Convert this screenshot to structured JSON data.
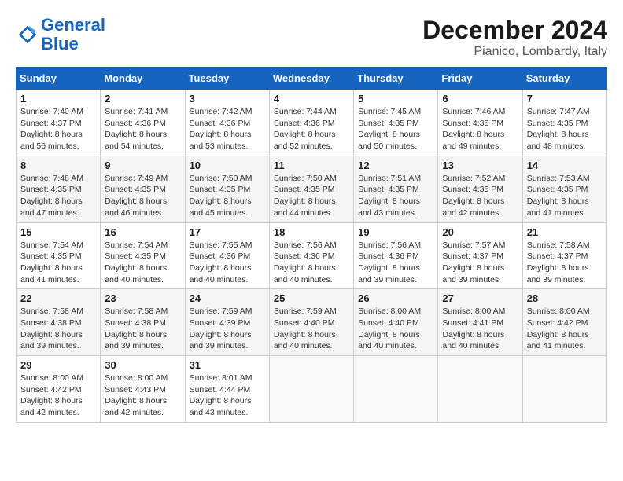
{
  "header": {
    "logo_line1": "General",
    "logo_line2": "Blue",
    "month": "December 2024",
    "location": "Pianico, Lombardy, Italy"
  },
  "weekdays": [
    "Sunday",
    "Monday",
    "Tuesday",
    "Wednesday",
    "Thursday",
    "Friday",
    "Saturday"
  ],
  "weeks": [
    [
      {
        "day": "1",
        "sunrise": "7:40 AM",
        "sunset": "4:37 PM",
        "daylight": "8 hours and 56 minutes."
      },
      {
        "day": "2",
        "sunrise": "7:41 AM",
        "sunset": "4:36 PM",
        "daylight": "8 hours and 54 minutes."
      },
      {
        "day": "3",
        "sunrise": "7:42 AM",
        "sunset": "4:36 PM",
        "daylight": "8 hours and 53 minutes."
      },
      {
        "day": "4",
        "sunrise": "7:44 AM",
        "sunset": "4:36 PM",
        "daylight": "8 hours and 52 minutes."
      },
      {
        "day": "5",
        "sunrise": "7:45 AM",
        "sunset": "4:35 PM",
        "daylight": "8 hours and 50 minutes."
      },
      {
        "day": "6",
        "sunrise": "7:46 AM",
        "sunset": "4:35 PM",
        "daylight": "8 hours and 49 minutes."
      },
      {
        "day": "7",
        "sunrise": "7:47 AM",
        "sunset": "4:35 PM",
        "daylight": "8 hours and 48 minutes."
      }
    ],
    [
      {
        "day": "8",
        "sunrise": "7:48 AM",
        "sunset": "4:35 PM",
        "daylight": "8 hours and 47 minutes."
      },
      {
        "day": "9",
        "sunrise": "7:49 AM",
        "sunset": "4:35 PM",
        "daylight": "8 hours and 46 minutes."
      },
      {
        "day": "10",
        "sunrise": "7:50 AM",
        "sunset": "4:35 PM",
        "daylight": "8 hours and 45 minutes."
      },
      {
        "day": "11",
        "sunrise": "7:50 AM",
        "sunset": "4:35 PM",
        "daylight": "8 hours and 44 minutes."
      },
      {
        "day": "12",
        "sunrise": "7:51 AM",
        "sunset": "4:35 PM",
        "daylight": "8 hours and 43 minutes."
      },
      {
        "day": "13",
        "sunrise": "7:52 AM",
        "sunset": "4:35 PM",
        "daylight": "8 hours and 42 minutes."
      },
      {
        "day": "14",
        "sunrise": "7:53 AM",
        "sunset": "4:35 PM",
        "daylight": "8 hours and 41 minutes."
      }
    ],
    [
      {
        "day": "15",
        "sunrise": "7:54 AM",
        "sunset": "4:35 PM",
        "daylight": "8 hours and 41 minutes."
      },
      {
        "day": "16",
        "sunrise": "7:54 AM",
        "sunset": "4:35 PM",
        "daylight": "8 hours and 40 minutes."
      },
      {
        "day": "17",
        "sunrise": "7:55 AM",
        "sunset": "4:36 PM",
        "daylight": "8 hours and 40 minutes."
      },
      {
        "day": "18",
        "sunrise": "7:56 AM",
        "sunset": "4:36 PM",
        "daylight": "8 hours and 40 minutes."
      },
      {
        "day": "19",
        "sunrise": "7:56 AM",
        "sunset": "4:36 PM",
        "daylight": "8 hours and 39 minutes."
      },
      {
        "day": "20",
        "sunrise": "7:57 AM",
        "sunset": "4:37 PM",
        "daylight": "8 hours and 39 minutes."
      },
      {
        "day": "21",
        "sunrise": "7:58 AM",
        "sunset": "4:37 PM",
        "daylight": "8 hours and 39 minutes."
      }
    ],
    [
      {
        "day": "22",
        "sunrise": "7:58 AM",
        "sunset": "4:38 PM",
        "daylight": "8 hours and 39 minutes."
      },
      {
        "day": "23",
        "sunrise": "7:58 AM",
        "sunset": "4:38 PM",
        "daylight": "8 hours and 39 minutes."
      },
      {
        "day": "24",
        "sunrise": "7:59 AM",
        "sunset": "4:39 PM",
        "daylight": "8 hours and 39 minutes."
      },
      {
        "day": "25",
        "sunrise": "7:59 AM",
        "sunset": "4:40 PM",
        "daylight": "8 hours and 40 minutes."
      },
      {
        "day": "26",
        "sunrise": "8:00 AM",
        "sunset": "4:40 PM",
        "daylight": "8 hours and 40 minutes."
      },
      {
        "day": "27",
        "sunrise": "8:00 AM",
        "sunset": "4:41 PM",
        "daylight": "8 hours and 40 minutes."
      },
      {
        "day": "28",
        "sunrise": "8:00 AM",
        "sunset": "4:42 PM",
        "daylight": "8 hours and 41 minutes."
      }
    ],
    [
      {
        "day": "29",
        "sunrise": "8:00 AM",
        "sunset": "4:42 PM",
        "daylight": "8 hours and 42 minutes."
      },
      {
        "day": "30",
        "sunrise": "8:00 AM",
        "sunset": "4:43 PM",
        "daylight": "8 hours and 42 minutes."
      },
      {
        "day": "31",
        "sunrise": "8:01 AM",
        "sunset": "4:44 PM",
        "daylight": "8 hours and 43 minutes."
      },
      null,
      null,
      null,
      null
    ]
  ]
}
